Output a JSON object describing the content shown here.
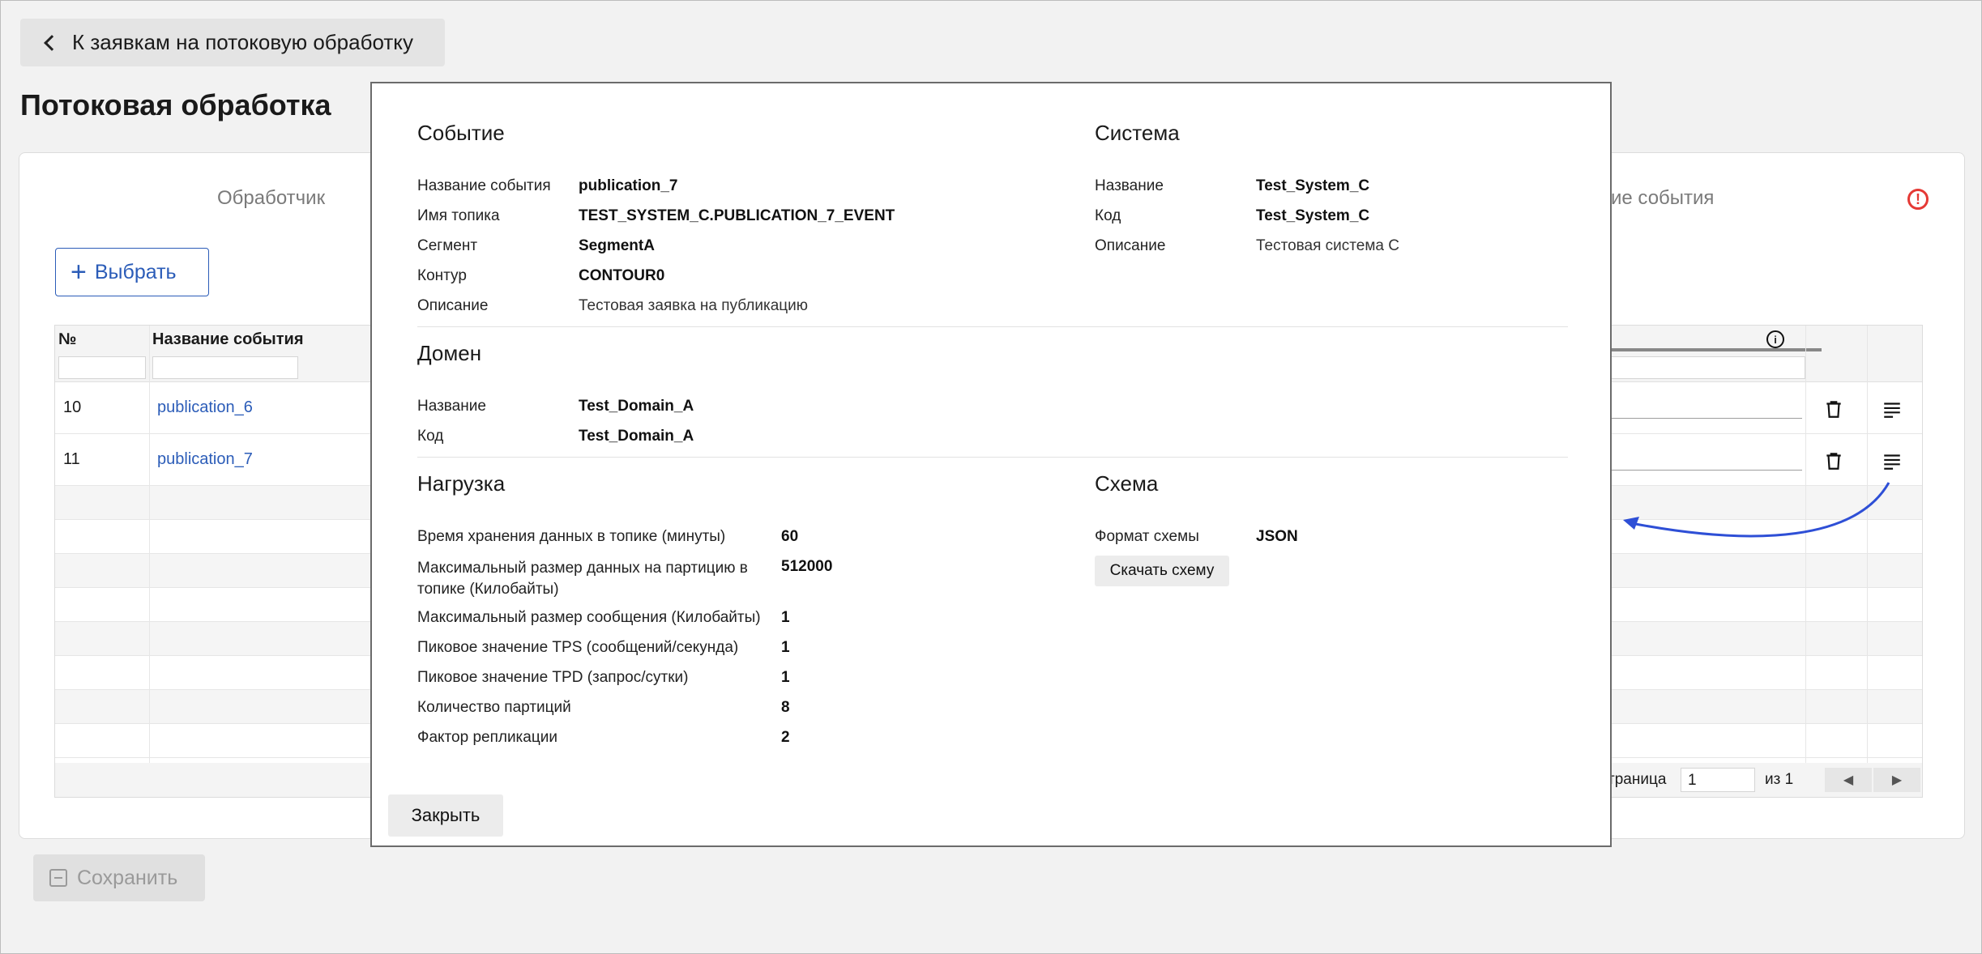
{
  "back_button": {
    "label": "К заявкам на потоковую обработку"
  },
  "page_title": "Потоковая обработка",
  "tabs": {
    "handler": "Обработчик",
    "events_partial": "ие события"
  },
  "select_button": {
    "label": "Выбрать"
  },
  "grid": {
    "columns": {
      "num": "№",
      "event_name": "Название события"
    },
    "rows": [
      {
        "num": "10",
        "event_name": "publication_6"
      },
      {
        "num": "11",
        "event_name": "publication_7"
      }
    ],
    "footer": {
      "page_label": "траница",
      "page_value": "1",
      "of_label": "из 1"
    }
  },
  "save_button": {
    "label": "Сохранить"
  },
  "modal": {
    "event": {
      "title": "Событие",
      "fields": [
        {
          "label": "Название события",
          "value": "publication_7",
          "bold": true
        },
        {
          "label": "Имя топика",
          "value": "TEST_SYSTEM_C.PUBLICATION_7_EVENT",
          "bold": true
        },
        {
          "label": "Сегмент",
          "value": "SegmentA",
          "bold": true
        },
        {
          "label": "Контур",
          "value": "CONTOUR0",
          "bold": true
        },
        {
          "label": "Описание",
          "value": "Тестовая заявка на публикацию",
          "bold": false
        }
      ]
    },
    "system": {
      "title": "Система",
      "fields": [
        {
          "label": "Название",
          "value": "Test_System_C",
          "bold": true
        },
        {
          "label": "Код",
          "value": "Test_System_C",
          "bold": true
        },
        {
          "label": "Описание",
          "value": "Тестовая система С",
          "bold": false
        }
      ]
    },
    "domain": {
      "title": "Домен",
      "fields": [
        {
          "label": "Название",
          "value": "Test_Domain_A"
        },
        {
          "label": "Код",
          "value": "Test_Domain_A"
        }
      ]
    },
    "load": {
      "title": "Нагрузка",
      "fields": [
        {
          "label": "Время хранения данных в топике (минуты)",
          "value": "60"
        },
        {
          "label": "Максимальный размер данных на партицию в топике (Килобайты)",
          "value": "512000"
        },
        {
          "label": "Максимальный размер сообщения (Килобайты)",
          "value": "1"
        },
        {
          "label": "Пиковое значение TPS (сообщений/секунда)",
          "value": "1"
        },
        {
          "label": "Пиковое значение TPD (запрос/сутки)",
          "value": "1"
        },
        {
          "label": "Количество партиций",
          "value": "8"
        },
        {
          "label": "Фактор репликации",
          "value": "2"
        }
      ]
    },
    "schema": {
      "title": "Схема",
      "format_label": "Формат схемы",
      "format_value": "JSON",
      "download_label": "Скачать схему"
    },
    "close_label": "Закрыть"
  },
  "colors": {
    "accent": "#2b5cb8",
    "alert": "#e53935",
    "annotation_arrow": "#2e4fd6"
  }
}
